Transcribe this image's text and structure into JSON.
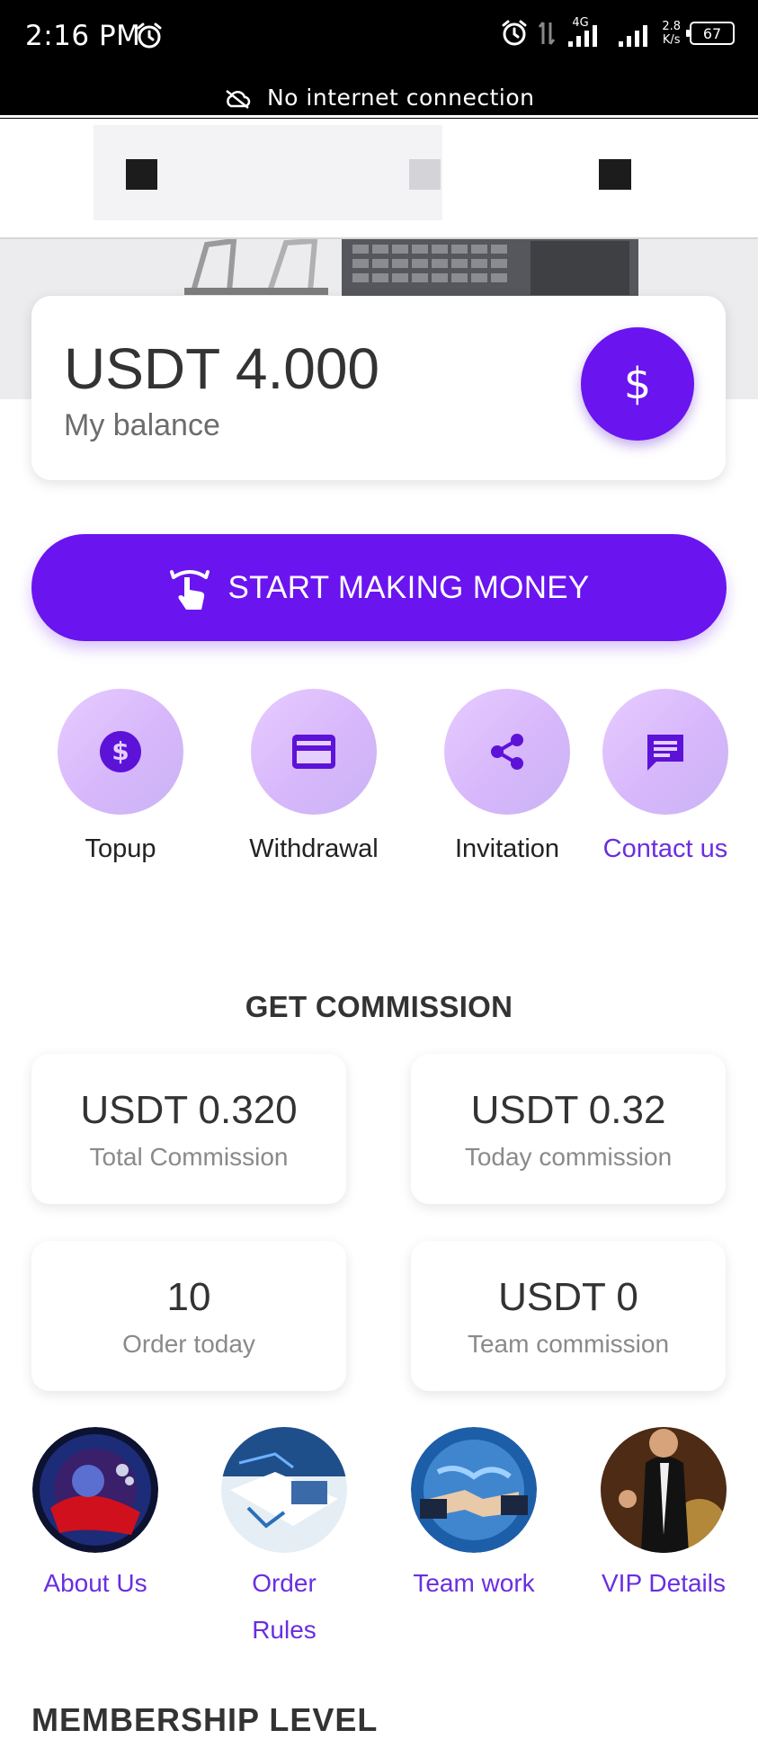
{
  "status_bar": {
    "time": "2:16 PM",
    "network_label": "4G",
    "speed_value": "2.8",
    "speed_unit": "K/s",
    "battery": "67",
    "connection_message": "No internet connection"
  },
  "balance": {
    "amount": "USDT 4.000",
    "label": "My balance",
    "button_icon": "$"
  },
  "start_button": {
    "label": "START MAKING MONEY"
  },
  "quick_actions": [
    {
      "label": "Topup",
      "icon": "dollar-circle-icon"
    },
    {
      "label": "Withdrawal",
      "icon": "credit-card-icon"
    },
    {
      "label": "Invitation",
      "icon": "share-icon"
    },
    {
      "label": "Contact us",
      "icon": "chat-icon"
    }
  ],
  "commission": {
    "title": "GET COMMISSION",
    "stats": [
      {
        "value": "USDT 0.320",
        "label": "Total Commission"
      },
      {
        "value": "USDT 0.32",
        "label": "Today commission"
      },
      {
        "value": "10",
        "label": "Order today"
      },
      {
        "value": "USDT 0",
        "label": "Team commission"
      }
    ]
  },
  "info_tiles": [
    {
      "line1": "About Us",
      "line2": ""
    },
    {
      "line1": "Order",
      "line2": "Rules"
    },
    {
      "line1": "Team work",
      "line2": ""
    },
    {
      "line1": "VIP Details",
      "line2": ""
    }
  ],
  "next_section_title": "MEMBERSHIP LEVEL",
  "colors": {
    "accent": "#6a14f0",
    "accent_text": "#6a2ee0",
    "tile_gradient_start": "#e7ccff"
  }
}
